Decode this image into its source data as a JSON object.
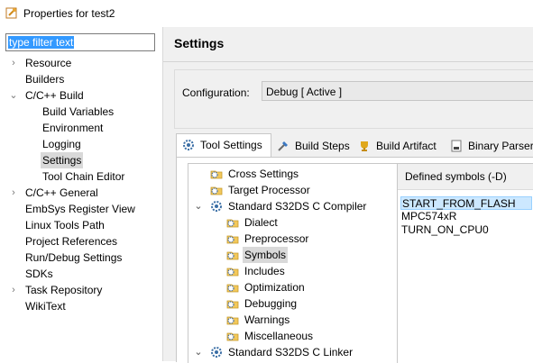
{
  "window": {
    "title": "Properties for test2"
  },
  "left": {
    "filter_value": "type filter text",
    "items": [
      {
        "label": "Resource",
        "chev": "›",
        "indent": 0
      },
      {
        "label": "Builders",
        "chev": "",
        "indent": 0
      },
      {
        "label": "C/C++ Build",
        "chev": "⌄",
        "indent": 0
      },
      {
        "label": "Build Variables",
        "chev": "",
        "indent": 1
      },
      {
        "label": "Environment",
        "chev": "",
        "indent": 1
      },
      {
        "label": "Logging",
        "chev": "",
        "indent": 1
      },
      {
        "label": "Settings",
        "chev": "",
        "indent": 1,
        "selected": true
      },
      {
        "label": "Tool Chain Editor",
        "chev": "",
        "indent": 1
      },
      {
        "label": "C/C++ General",
        "chev": "›",
        "indent": 0
      },
      {
        "label": "EmbSys Register View",
        "chev": "",
        "indent": 0
      },
      {
        "label": "Linux Tools Path",
        "chev": "",
        "indent": 0
      },
      {
        "label": "Project References",
        "chev": "",
        "indent": 0
      },
      {
        "label": "Run/Debug Settings",
        "chev": "",
        "indent": 0
      },
      {
        "label": "SDKs",
        "chev": "",
        "indent": 0
      },
      {
        "label": "Task Repository",
        "chev": "›",
        "indent": 0
      },
      {
        "label": "WikiText",
        "chev": "",
        "indent": 0
      }
    ]
  },
  "settings": {
    "title": "Settings",
    "config_label": "Configuration:",
    "config_value": "Debug  [ Active ]",
    "tabs": [
      "Tool Settings",
      "Build Steps",
      "Build Artifact",
      "Binary Parsers"
    ],
    "tool_tree": [
      {
        "label": "Cross Settings",
        "level": 1,
        "chev": "",
        "icon": "folder-gear"
      },
      {
        "label": "Target Processor",
        "level": 1,
        "chev": "",
        "icon": "folder-gear"
      },
      {
        "label": "Standard S32DS C Compiler",
        "level": 1,
        "chev": "⌄",
        "icon": "gear"
      },
      {
        "label": "Dialect",
        "level": 2,
        "chev": "",
        "icon": "folder-gear"
      },
      {
        "label": "Preprocessor",
        "level": 2,
        "chev": "",
        "icon": "folder-gear"
      },
      {
        "label": "Symbols",
        "level": 2,
        "chev": "",
        "icon": "folder-gear",
        "selected": true
      },
      {
        "label": "Includes",
        "level": 2,
        "chev": "",
        "icon": "folder-gear"
      },
      {
        "label": "Optimization",
        "level": 2,
        "chev": "",
        "icon": "folder-gear"
      },
      {
        "label": "Debugging",
        "level": 2,
        "chev": "",
        "icon": "folder-gear"
      },
      {
        "label": "Warnings",
        "level": 2,
        "chev": "",
        "icon": "folder-gear"
      },
      {
        "label": "Miscellaneous",
        "level": 2,
        "chev": "",
        "icon": "folder-gear"
      },
      {
        "label": "Standard S32DS C Linker",
        "level": 1,
        "chev": "⌄",
        "icon": "gear"
      }
    ],
    "symbols_header": "Defined symbols (-D)",
    "symbols": [
      "START_FROM_FLASH",
      "MPC574xR",
      "TURN_ON_CPU0"
    ]
  },
  "colors": {
    "selection": "#3399ff",
    "list_selection": "#cce8ff",
    "row_selected": "#d9d9d9"
  }
}
